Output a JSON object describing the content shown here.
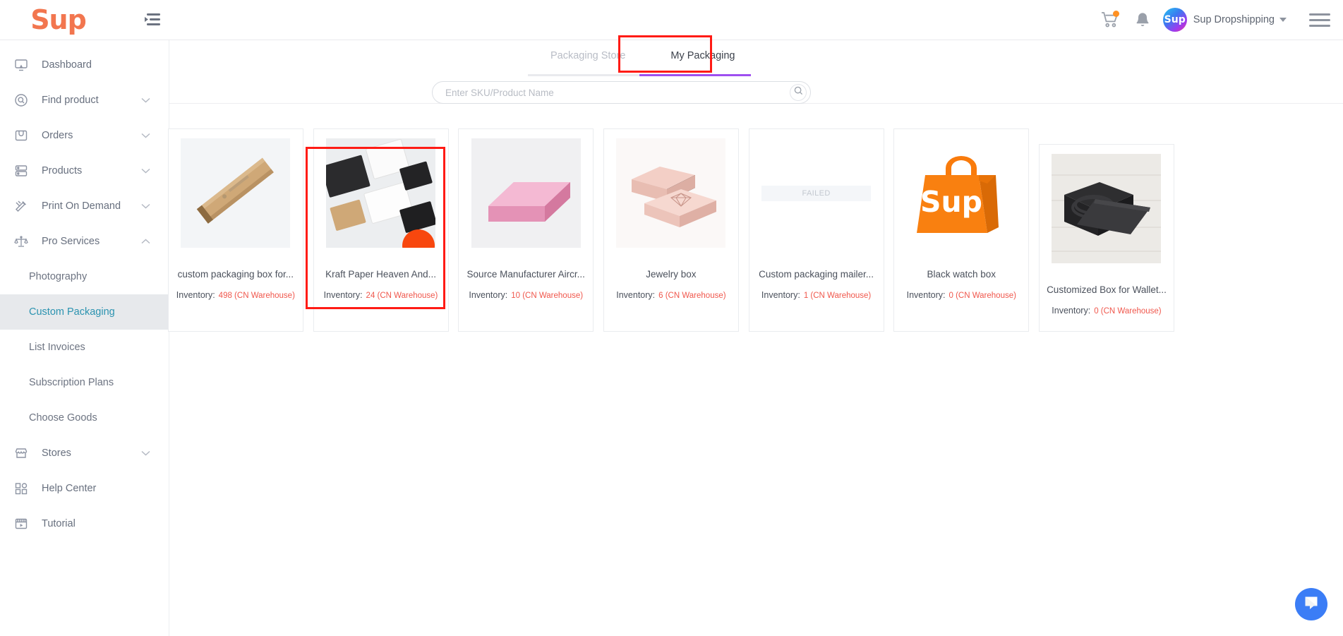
{
  "header": {
    "logo_text": "Sup",
    "collapse_icon": "collapse-menu-icon",
    "cart_icon": "shopping-cart-icon",
    "bell_icon": "notification-bell-icon",
    "avatar_text": "Sup",
    "username": "Sup Dropshipping",
    "menu_icon": "hamburger-menu-icon"
  },
  "sidebar": {
    "items": [
      {
        "label": "Dashboard",
        "icon": "dashboard-icon",
        "expandable": false
      },
      {
        "label": "Find product",
        "icon": "search-circle-icon",
        "expandable": true,
        "expanded": false
      },
      {
        "label": "Orders",
        "icon": "orders-box-icon",
        "expandable": true,
        "expanded": false
      },
      {
        "label": "Products",
        "icon": "products-stack-icon",
        "expandable": true,
        "expanded": false
      },
      {
        "label": "Print On Demand",
        "icon": "print-on-demand-icon",
        "expandable": true,
        "expanded": false
      },
      {
        "label": "Pro Services",
        "icon": "scales-icon",
        "expandable": true,
        "expanded": true
      }
    ],
    "pro_services_children": [
      {
        "label": "Photography",
        "active": false
      },
      {
        "label": "Custom Packaging",
        "active": true
      },
      {
        "label": "List Invoices",
        "active": false
      },
      {
        "label": "Subscription Plans",
        "active": false
      },
      {
        "label": "Choose Goods",
        "active": false
      }
    ],
    "bottom_items": [
      {
        "label": "Stores",
        "icon": "store-icon",
        "expandable": true,
        "expanded": false
      },
      {
        "label": "Help Center",
        "icon": "help-center-icon",
        "expandable": false
      },
      {
        "label": "Tutorial",
        "icon": "tutorial-video-icon",
        "expandable": false
      }
    ]
  },
  "main": {
    "tabs": [
      {
        "label": "Packaging Store",
        "active": false
      },
      {
        "label": "My Packaging",
        "active": true
      }
    ],
    "search": {
      "placeholder": "Enter SKU/Product Name",
      "value": "",
      "button_icon": "search-icon"
    },
    "inventory_label": "Inventory:",
    "failed_text": "FAILED",
    "cards": [
      {
        "title": "custom packaging box for...",
        "inventory": "498 (CN Warehouse)",
        "image": "kraft-long-box-photo",
        "failed": false
      },
      {
        "title": "Kraft Paper Heaven And...",
        "inventory": "24 (CN Warehouse)",
        "image": "assorted-boxes-photo",
        "failed": false
      },
      {
        "title": "Source Manufacturer Aircr...",
        "inventory": "10 (CN Warehouse)",
        "image": "pink-mailer-box-photo",
        "failed": false
      },
      {
        "title": "Jewelry box",
        "inventory": "6 (CN Warehouse)",
        "image": "pink-jewelry-box-photo",
        "failed": false
      },
      {
        "title": "Custom packaging mailer...",
        "inventory": "1 (CN Warehouse)",
        "image": "broken-image-placeholder",
        "failed": true
      },
      {
        "title": "Black watch box",
        "inventory": "0 (CN Warehouse)",
        "image": "sup-shopping-bag-logo",
        "failed": false
      },
      {
        "title": "Customized Box for Wallet...",
        "inventory": "0 (CN Warehouse)",
        "image": "black-gift-box-belt-photo",
        "failed": false
      }
    ]
  },
  "chat": {
    "icon": "chat-bubble-icon"
  },
  "colors": {
    "brand_orange": "#f2764f",
    "tab_accent": "#9e4ff0",
    "inventory_red": "#f0574c",
    "active_nav": "#2b93b0",
    "annotation_red": "#ff1b15",
    "chat_blue": "#3b7df6"
  }
}
